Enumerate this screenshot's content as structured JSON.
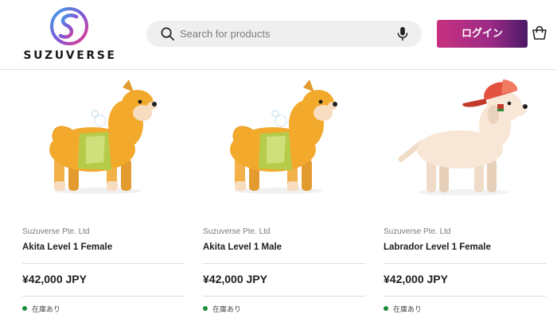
{
  "header": {
    "logo_text": "SUZUVERSE",
    "search": {
      "placeholder": "Search for products"
    },
    "login_label": "ログイン"
  },
  "icons": [
    "logo-mark",
    "search-icon",
    "mic-icon",
    "cart-icon"
  ],
  "colors": {
    "login_gradient": [
      "#c8317f",
      "#9a2a86",
      "#4b1a66"
    ],
    "in_stock": "#1e8c3c",
    "akita_body": "#f3aa2c",
    "akita_vest": "#b5cc4a",
    "labrador_body": "#f8e6d6",
    "cap": "#e4513f"
  },
  "products": [
    {
      "image": "akita-female-dog",
      "vendor": "Suzuverse Pte. Ltd",
      "title": "Akita Level 1 Female",
      "price": "¥42,000 JPY",
      "stock": "在庫あり"
    },
    {
      "image": "akita-male-dog",
      "vendor": "Suzuverse Pte. Ltd",
      "title": "Akita Level 1 Male",
      "price": "¥42,000 JPY",
      "stock": "在庫あり"
    },
    {
      "image": "labrador-female-dog",
      "vendor": "Suzuverse Pte. Ltd",
      "title": "Labrador Level 1 Female",
      "price": "¥42,000 JPY",
      "stock": "在庫あり"
    }
  ]
}
